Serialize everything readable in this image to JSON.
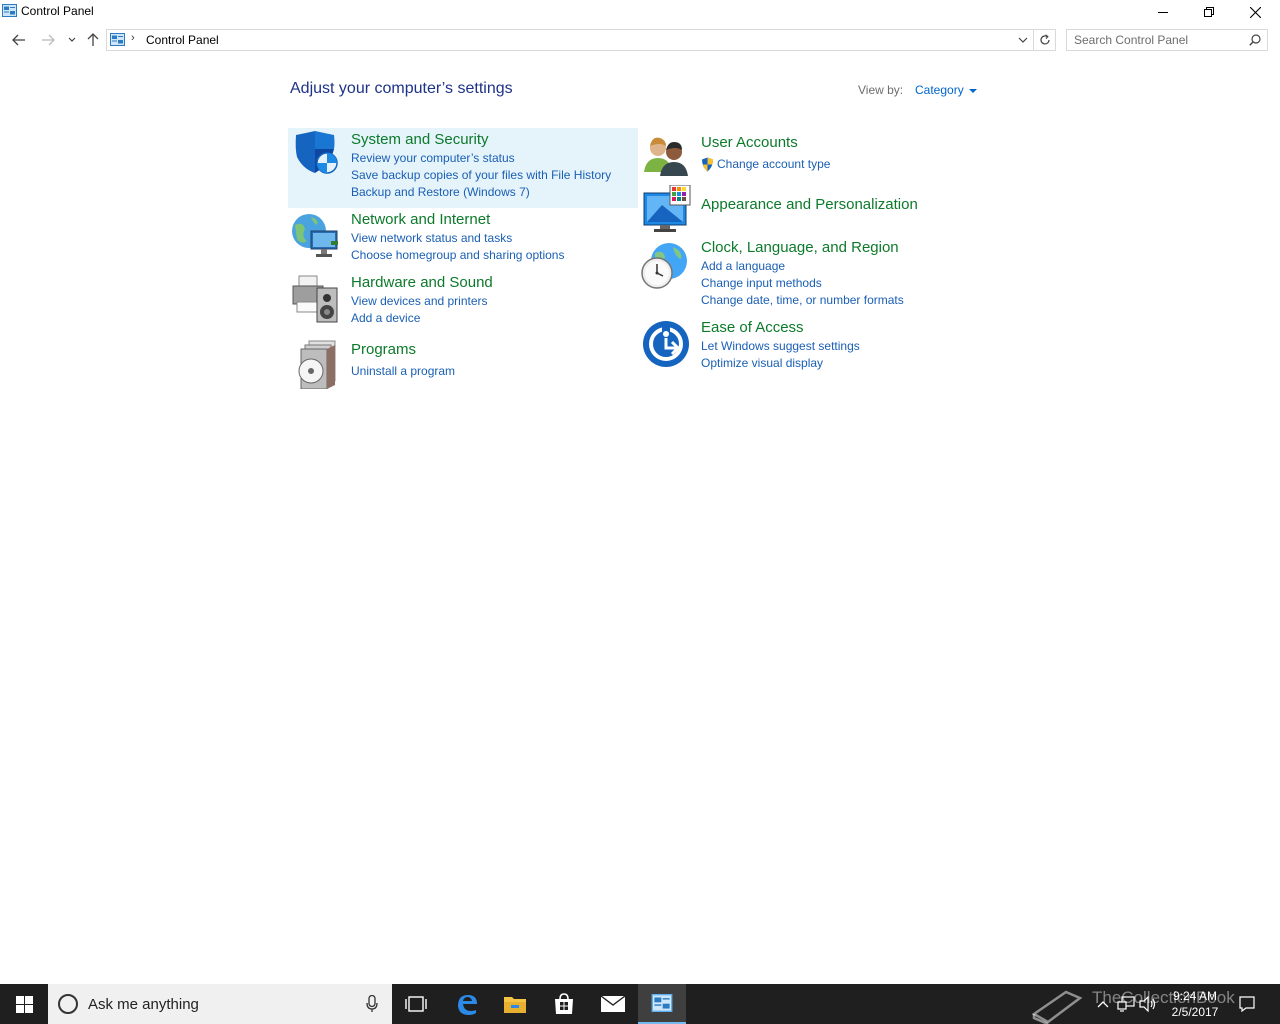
{
  "window": {
    "title": "Control Panel",
    "minimize_icon": "minimize-icon",
    "maximize_icon": "restore-icon",
    "close_icon": "close-icon"
  },
  "navigation": {
    "back_icon": "back-arrow-icon",
    "forward_icon": "forward-arrow-icon",
    "recent_icon": "chevron-down-icon",
    "up_icon": "up-arrow-icon"
  },
  "address_bar": {
    "breadcrumb_icon": "control-panel-icon",
    "separator": "›",
    "breadcrumb": "Control Panel",
    "dropdown_icon": "chevron-down-icon",
    "refresh_icon": "refresh-icon"
  },
  "search": {
    "placeholder": "Search Control Panel",
    "icon": "search-icon"
  },
  "content": {
    "heading": "Adjust your computer’s settings",
    "view_by_label": "View by:",
    "view_by_value": "Category"
  },
  "categories": [
    {
      "title": "System and Security",
      "icon": "shield-icon",
      "links": [
        "Review your computer’s status",
        "Save backup copies of your files with File History",
        "Backup and Restore (Windows 7)"
      ]
    },
    {
      "title": "Network and Internet",
      "icon": "network-globe-icon",
      "links": [
        "View network status and tasks",
        "Choose homegroup and sharing options"
      ]
    },
    {
      "title": "Hardware and Sound",
      "icon": "printer-speaker-icon",
      "links": [
        "View devices and printers",
        "Add a device"
      ]
    },
    {
      "title": "Programs",
      "icon": "programs-disc-icon",
      "links": [
        "Uninstall a program"
      ]
    },
    {
      "title": "User Accounts",
      "icon": "users-icon",
      "links": [
        "Change account type"
      ],
      "link_icon": "uac-shield-icon"
    },
    {
      "title": "Appearance and Personalization",
      "icon": "monitor-palette-icon",
      "links": []
    },
    {
      "title": "Clock, Language, and Region",
      "icon": "clock-globe-icon",
      "links": [
        "Add a language",
        "Change input methods",
        "Change date, time, or number formats"
      ]
    },
    {
      "title": "Ease of Access",
      "icon": "ease-of-access-icon",
      "links": [
        "Let Windows suggest settings",
        "Optimize visual display"
      ]
    }
  ],
  "taskbar": {
    "search_placeholder": "Ask me anything",
    "time": "9:24 AM",
    "date": "2/5/2017",
    "apps": [
      "task-view-icon",
      "edge-icon",
      "file-explorer-icon",
      "store-icon",
      "mail-icon",
      "control-panel-icon"
    ],
    "tray": [
      "show-hidden-icons-icon",
      "network-icon",
      "volume-icon",
      "action-center-icon"
    ],
    "watermark": "TheCollectionBook"
  },
  "colors": {
    "heading": "#1e3287",
    "category_title": "#0d7a2b",
    "link": "#1a5fb4",
    "highlight": "#e5f3fb",
    "taskbar": "#1f1f1f"
  }
}
